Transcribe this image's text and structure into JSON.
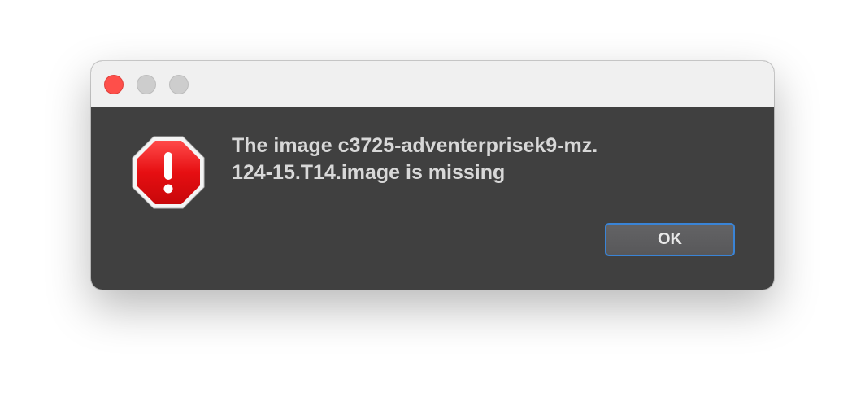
{
  "window": {
    "controls": [
      "close",
      "minimize",
      "zoom"
    ]
  },
  "alert": {
    "icon": "stop-exclamation-icon",
    "message_line1": "The image c3725-adventerprisek9-mz.",
    "message_line2": "124-15.T14.image is missing"
  },
  "buttons": {
    "ok_label": "OK"
  },
  "colors": {
    "close_button": "#fe4f4a",
    "inactive_button": "#cdcdcd",
    "dialog_body": "#404040",
    "titlebar": "#f0f0f0",
    "icon_red": "#e00d10",
    "focus_ring": "#3a84d6"
  }
}
